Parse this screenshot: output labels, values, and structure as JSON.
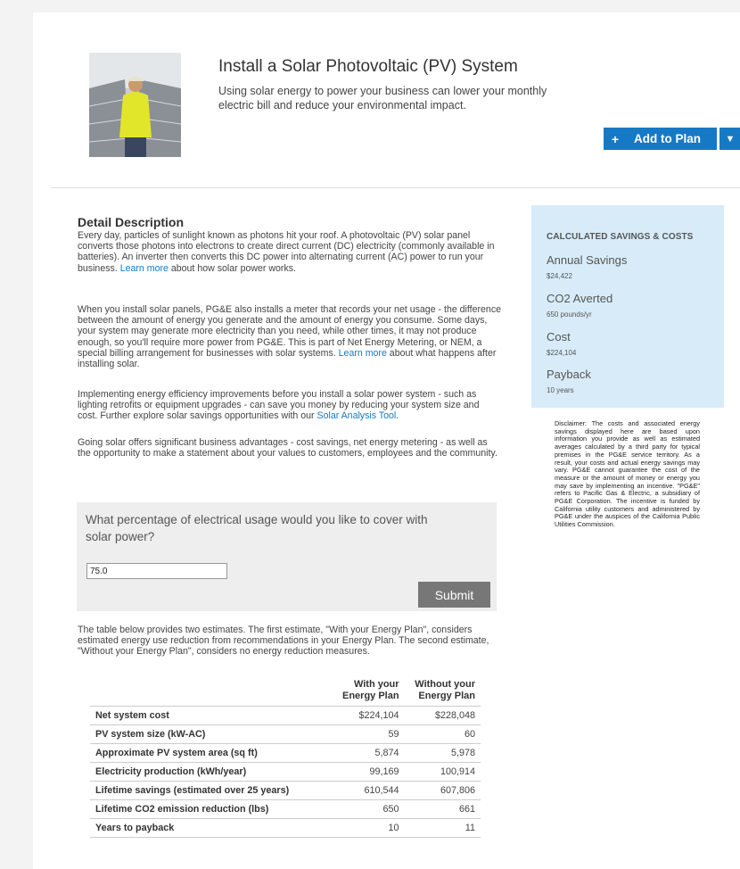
{
  "header": {
    "title": "Install a Solar Photovoltaic (PV) System",
    "subtitle": "Using solar energy to power your business can lower your monthly electric bill and reduce your environmental impact.",
    "add_button_label": "Add to Plan",
    "add_button_icon": "plus-icon",
    "dropdown_icon": "chevron-down-icon"
  },
  "detail": {
    "title": "Detail Description",
    "p1_text": "Every day, particles of sunlight known as photons hit your roof. A photovoltaic (PV) solar panel converts those photons into electrons to create direct current (DC) electricity (commonly available in batteries). An inverter then converts this DC power into alternating current (AC) power to run your business.",
    "p1_link": "Learn more",
    "p1_tail": "about how solar power works.",
    "p2_text": "When you install solar panels, PG&E also installs a meter that records your net usage - the difference between the amount of energy you generate and the amount of energy you consume. Some days, your system may generate more electricity than you need, while other times, it may not produce enough, so you'll require more power from PG&E. This is part of Net Energy Metering, or NEM, a special billing arrangement for businesses with solar systems.",
    "p2_link": "Learn more",
    "p2_tail": "about what happens after installing solar.",
    "p3_text": "Implementing energy efficiency improvements before you install a solar power system - such as lighting retrofits or equipment upgrades - can save you money by reducing your system size and cost. Further explore solar savings opportunities with our",
    "p3_link": "Solar Analysis Tool",
    "p3_tail": ".",
    "p4_text": "Going solar offers significant business advantages - cost savings, net energy metering - as well as the opportunity to make a statement about your values to customers, employees and the community."
  },
  "question": {
    "text": "What percentage of electrical usage would you like to cover with solar power?",
    "value": "75.0",
    "submit_label": "Submit"
  },
  "table_intro": "The table below provides two estimates. The first estimate, \"With your Energy Plan\", considers estimated energy use reduction from recommendations in your Energy Plan. The second estimate, \"Without your Energy Plan\", considers no energy reduction measures.",
  "table": {
    "headers": [
      "",
      "With your Energy Plan",
      "Without your Energy Plan"
    ],
    "rows": [
      [
        "Net system cost",
        "$224,104",
        "$228,048"
      ],
      [
        "PV system size (kW-AC)",
        "59",
        "60"
      ],
      [
        "Approximate PV system area (sq ft)",
        "5,874",
        "5,978"
      ],
      [
        "Electricity production (kWh/year)",
        "99,169",
        "100,914"
      ],
      [
        "Lifetime savings (estimated over 25 years)",
        "610,544",
        "607,806"
      ],
      [
        "Lifetime CO2 emission reduction (lbs)",
        "650",
        "661"
      ],
      [
        "Years to payback",
        "10",
        "11"
      ]
    ]
  },
  "savings": {
    "heading": "CALCULATED SAVINGS & COSTS",
    "items": [
      {
        "label": "Annual Savings",
        "value": "$24,422"
      },
      {
        "label": "CO2 Averted",
        "value": "650 pounds/yr"
      },
      {
        "label": "Cost",
        "value": "$224,104"
      },
      {
        "label": "Payback",
        "value": "10 years"
      }
    ]
  },
  "disclaimer": "Disclaimer: The costs and associated energy savings displayed here are based upon information you provide as well as estimated averages calculated by a third party for typical premises in the PG&E service territory. As a result, your costs and actual energy savings may vary. PG&E cannot guarantee the cost of the measure or the amount of money or energy you may save by implementing an incentive. \"PG&E\" refers to Pacific Gas & Electric, a subsidiary of PG&E Corporation. The incentive is funded by California utility customers and administered by PG&E under the auspices of the California Public Utilities Commission.",
  "colors": {
    "accent": "#1679c5",
    "panel_bg": "#d7ecf8",
    "question_bg": "#eeeeee",
    "submit_bg": "#777777"
  }
}
